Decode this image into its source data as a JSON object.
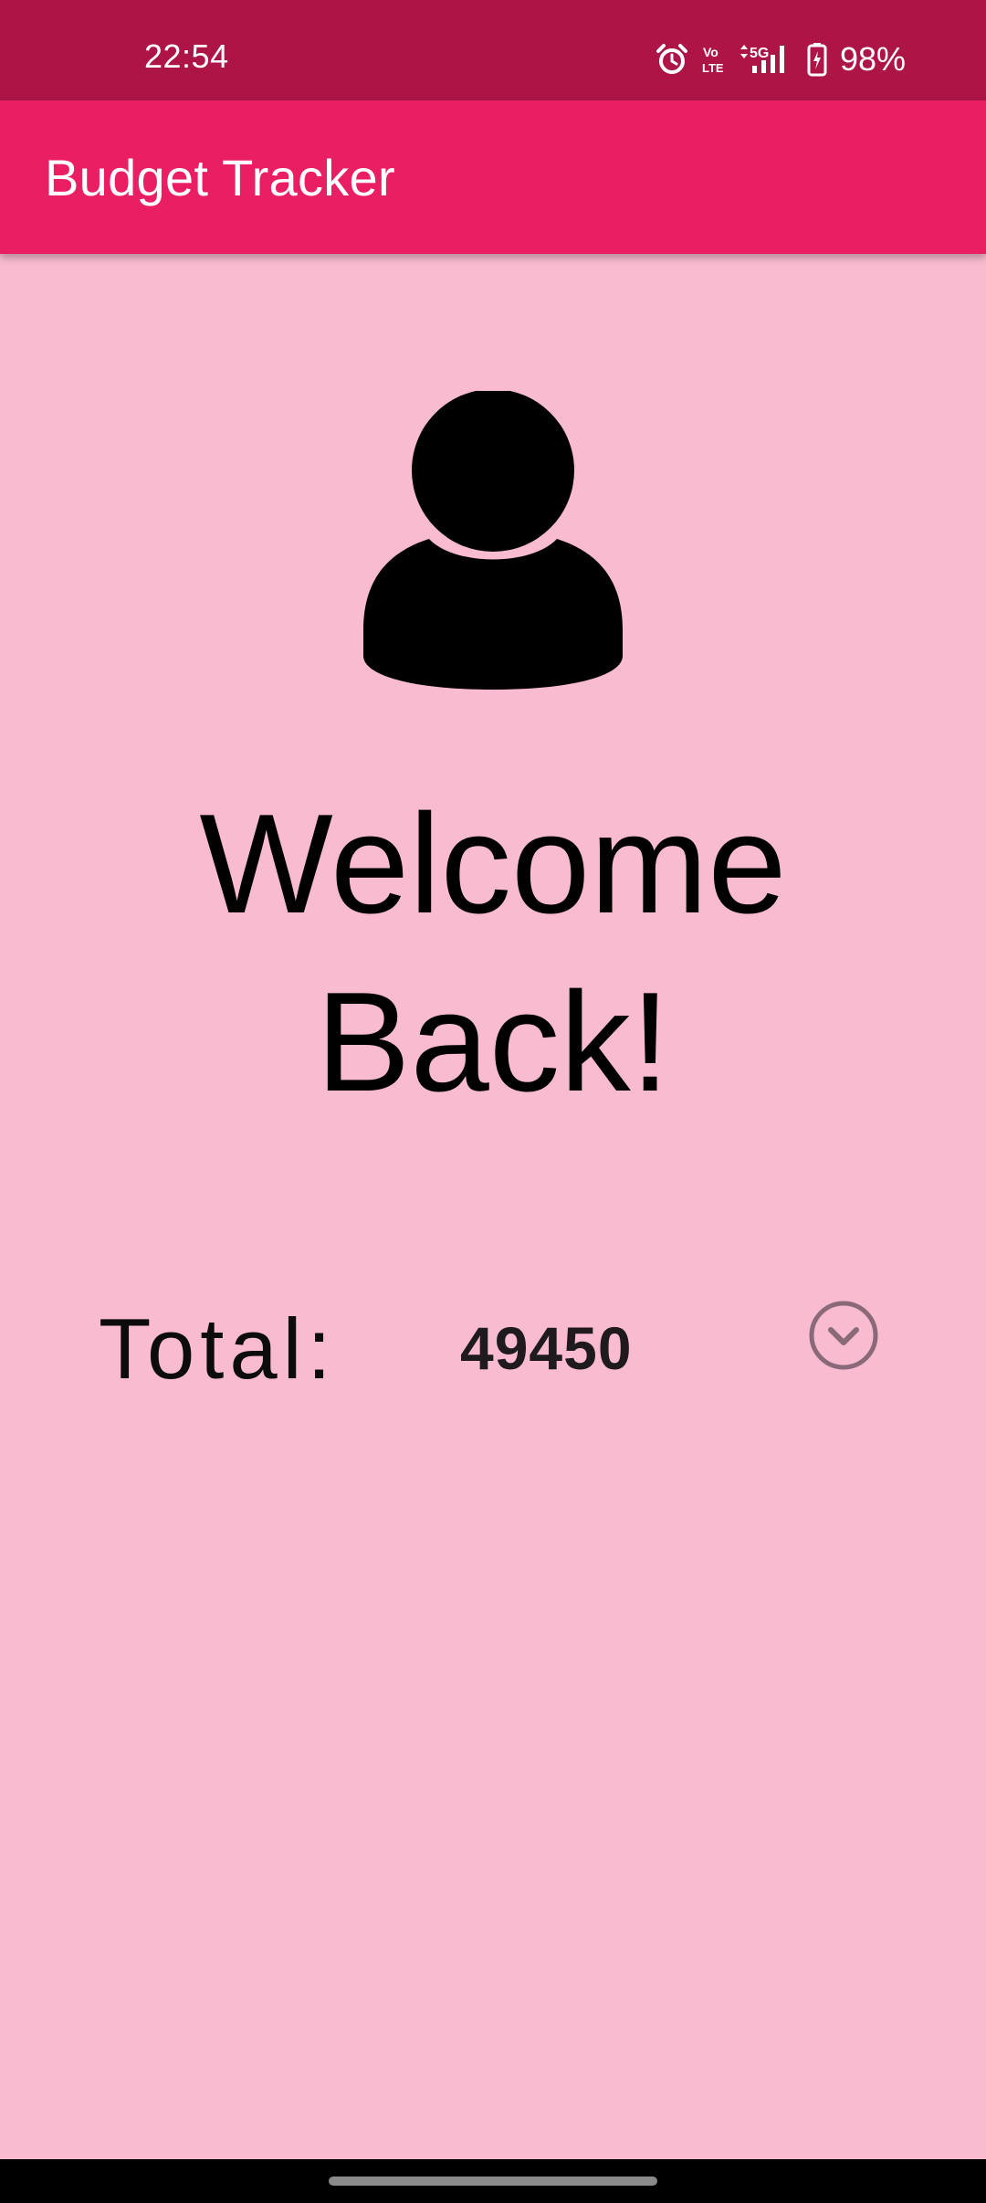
{
  "status_bar": {
    "time": "22:54",
    "battery_percent": "98%",
    "icons": [
      "alarm-icon",
      "volte-icon",
      "5g-signal-icon",
      "battery-icon"
    ]
  },
  "app_bar": {
    "title": "Budget Tracker"
  },
  "main": {
    "avatar_icon": "person-icon",
    "welcome_line1": "Welcome",
    "welcome_line2": "Back!",
    "total_label": "Total:",
    "total_value": "49450",
    "dropdown_icon": "chevron-down-circle-icon"
  },
  "colors": {
    "status_bar": "#ad1547",
    "app_bar": "#e91e63",
    "background": "#f8bbd0"
  }
}
